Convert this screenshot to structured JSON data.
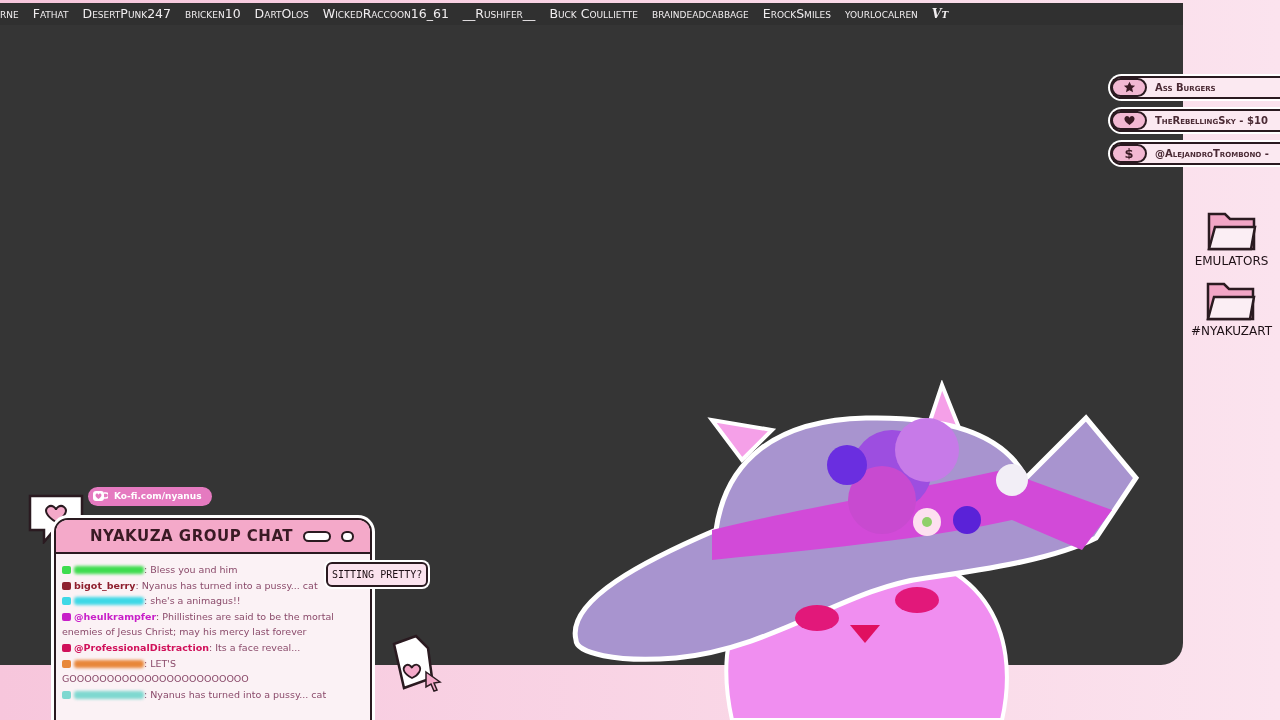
{
  "ticker": [
    "rne",
    "Fathat",
    "DesertPunk247",
    "bricken10",
    "DartOlos",
    "WickedRaccoon16_61",
    "__Rushifer__",
    "Buck Coulliette",
    "braindeadcabbage",
    "ErockSmiles",
    "yourlocalren",
    "Vt"
  ],
  "alerts": [
    {
      "kind": "star",
      "text": "Ass Burgers"
    },
    {
      "kind": "heart",
      "text": "TheRebellingSky - $10"
    },
    {
      "kind": "dollar",
      "symbol": "$",
      "text": "@AlejandroTrombono -"
    }
  ],
  "folders": [
    {
      "label": "EMULATORS"
    },
    {
      "label": "#NYAKUZART"
    }
  ],
  "kofi": "Ko-fi.com/nyanus",
  "chat": {
    "title": "NYAKUZA GROUP CHAT",
    "messages": [
      {
        "color": "#3fdc4f",
        "text": ": Bless you and him"
      },
      {
        "color": "#8e1f2e",
        "user": "bigot_berry",
        "text": ": Nyanus has turned into a pussy... cat"
      },
      {
        "color": "#3fd8e6",
        "text": ": she's a animagus!!"
      },
      {
        "color": "#c81ec8",
        "user": "@heulkrampfer",
        "text": ": Phillistines are said to be the mortal enemies of Jesus Christ; may his mercy last forever"
      },
      {
        "color": "#d0105a",
        "user": "@ProfessionalDistraction",
        "text": ": Its a face reveal..."
      },
      {
        "color": "#e8873a",
        "text": ": LET'S GOOOOOOOOOOOOOOOOOOOOOOOO"
      },
      {
        "color": "#7fd8d0",
        "text": ": Nyanus has turned into a pussy... cat"
      }
    ]
  },
  "bubble": "SITTING PRETTY?"
}
